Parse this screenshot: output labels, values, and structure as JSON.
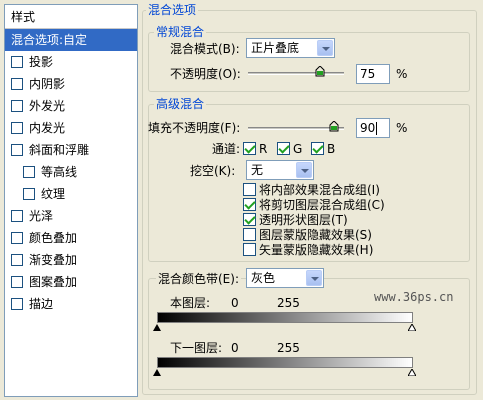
{
  "sidebar": {
    "title": "样式",
    "items": [
      {
        "label": "混合选项:自定",
        "checkbox": false,
        "selected": true,
        "indent": 0
      },
      {
        "label": "投影",
        "checkbox": true,
        "checked": false,
        "indent": 0
      },
      {
        "label": "内阴影",
        "checkbox": true,
        "checked": false,
        "indent": 0
      },
      {
        "label": "外发光",
        "checkbox": true,
        "checked": false,
        "indent": 0
      },
      {
        "label": "内发光",
        "checkbox": true,
        "checked": false,
        "indent": 0
      },
      {
        "label": "斜面和浮雕",
        "checkbox": true,
        "checked": false,
        "indent": 0
      },
      {
        "label": "等高线",
        "checkbox": true,
        "checked": false,
        "indent": 1
      },
      {
        "label": "纹理",
        "checkbox": true,
        "checked": false,
        "indent": 1
      },
      {
        "label": "光泽",
        "checkbox": true,
        "checked": false,
        "indent": 0
      },
      {
        "label": "颜色叠加",
        "checkbox": true,
        "checked": false,
        "indent": 0
      },
      {
        "label": "渐变叠加",
        "checkbox": true,
        "checked": false,
        "indent": 0
      },
      {
        "label": "图案叠加",
        "checkbox": true,
        "checked": false,
        "indent": 0
      },
      {
        "label": "描边",
        "checkbox": true,
        "checked": false,
        "indent": 0
      }
    ]
  },
  "blend_options": {
    "section_title": "混合选项",
    "general": {
      "title": "常规混合",
      "mode_label": "混合模式(B):",
      "mode_value": "正片叠底",
      "opacity_label": "不透明度(O):",
      "opacity_value": "75",
      "opacity_fraction": 0.75,
      "unit": "%"
    },
    "advanced": {
      "title": "高级混合",
      "fill_label": "填充不透明度(F):",
      "fill_value": "90",
      "fill_fraction": 0.9,
      "unit": "%",
      "channels_label": "通道:",
      "channels": [
        {
          "label": "R",
          "checked": true
        },
        {
          "label": "G",
          "checked": true
        },
        {
          "label": "B",
          "checked": true
        }
      ],
      "knockout_label": "挖空(K):",
      "knockout_value": "无",
      "options": [
        {
          "label": "将内部效果混合成组(I)",
          "checked": false
        },
        {
          "label": "将剪切图层混合成组(C)",
          "checked": true
        },
        {
          "label": "透明形状图层(T)",
          "checked": true
        },
        {
          "label": "图层蒙版隐藏效果(S)",
          "checked": false
        },
        {
          "label": "矢量蒙版隐藏效果(H)",
          "checked": false
        }
      ]
    },
    "blend_if": {
      "label": "混合颜色带(E):",
      "value": "灰色",
      "this_layer_label": "本图层:",
      "this_layer_min": "0",
      "this_layer_max": "255",
      "underlying_label": "下一图层:",
      "underlying_min": "0",
      "underlying_max": "255",
      "watermark": "www.36ps.cn"
    }
  },
  "colors": {
    "accent": "#0046d5",
    "selection": "#316ac5",
    "background": "#ece9d8"
  }
}
